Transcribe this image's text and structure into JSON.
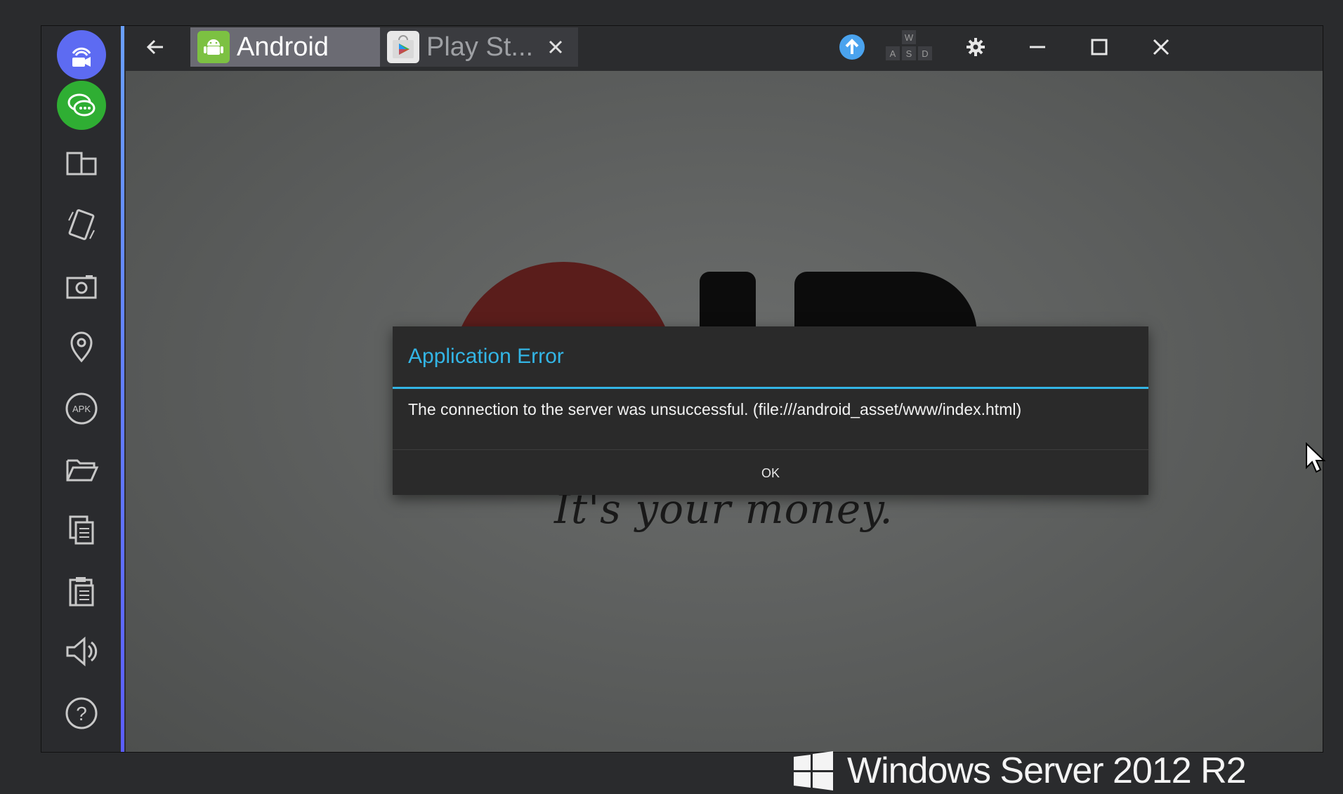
{
  "sidebar": {
    "items": [
      {
        "name": "video-camera-icon"
      },
      {
        "name": "chat-icon"
      },
      {
        "name": "multi-window-icon"
      },
      {
        "name": "rotate-icon"
      },
      {
        "name": "camera-icon"
      },
      {
        "name": "location-icon"
      },
      {
        "name": "apk-icon",
        "label": "APK"
      },
      {
        "name": "folder-icon"
      },
      {
        "name": "copy-icon"
      },
      {
        "name": "paste-icon"
      },
      {
        "name": "volume-icon"
      },
      {
        "name": "help-icon",
        "label": "?"
      }
    ]
  },
  "titlebar": {
    "tabs": [
      {
        "label": "Android",
        "active": true
      },
      {
        "label": "Play St...",
        "active": false
      }
    ],
    "keyboard_keys": [
      "W",
      "A",
      "S",
      "D"
    ]
  },
  "content": {
    "slogan": "It's your money."
  },
  "dialog": {
    "title": "Application Error",
    "message": "The connection to the server was unsuccessful. (file:///android_asset/www/index.html)",
    "ok_label": "OK"
  },
  "taskbar": {
    "os_label": "Windows Server 2012 R2"
  },
  "colors": {
    "accent": "#33b5e5",
    "sidebar_blue": "#5d6bf2",
    "sidebar_green": "#2fae33"
  }
}
